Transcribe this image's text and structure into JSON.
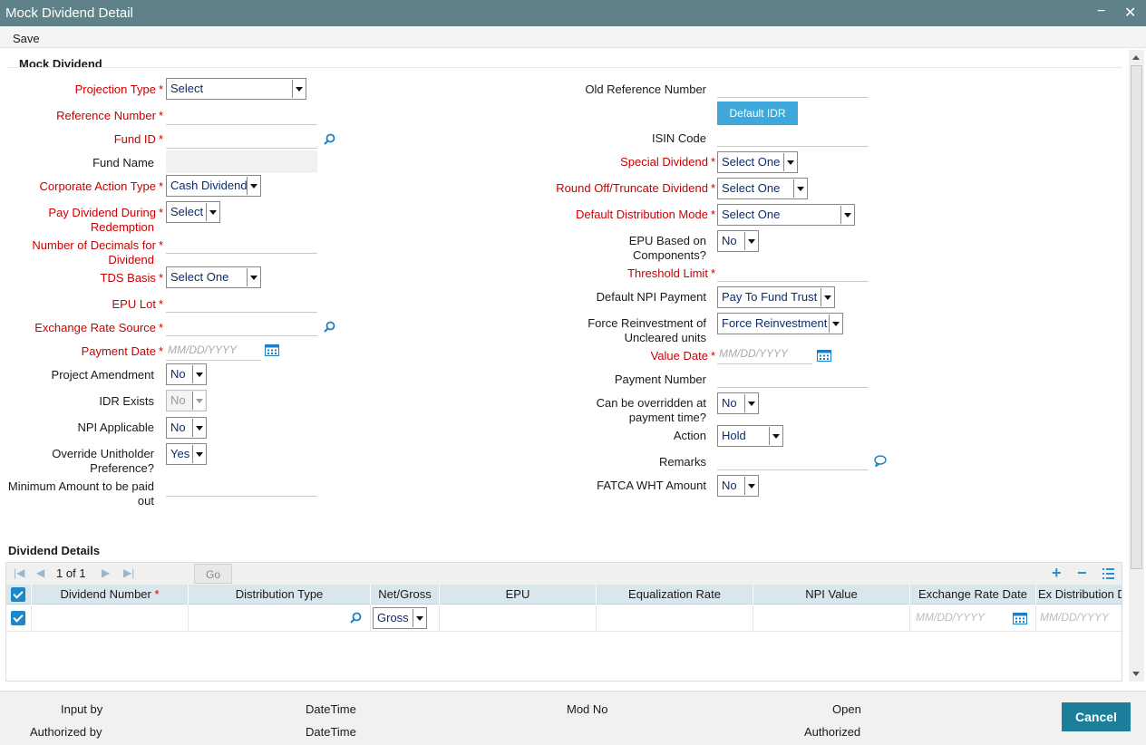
{
  "window": {
    "title": "Mock Dividend Detail",
    "minimize": "−",
    "close": "✕"
  },
  "toolbar": {
    "save": "Save"
  },
  "section": {
    "title": "Mock Dividend"
  },
  "left": {
    "projection_type": {
      "label": "Projection Type",
      "value": "Select"
    },
    "reference_number": {
      "label": "Reference Number"
    },
    "fund_id": {
      "label": "Fund ID"
    },
    "fund_name": {
      "label": "Fund Name"
    },
    "corporate_action_type": {
      "label": "Corporate Action Type",
      "value": "Cash Dividend"
    },
    "pay_dividend_during_redemption": {
      "label_1": "Pay Dividend During",
      "label_2": "Redemption",
      "value": "Select"
    },
    "number_of_decimals": {
      "label_1": "Number of Decimals for",
      "label_2": "Dividend"
    },
    "tds_basis": {
      "label": "TDS Basis",
      "value": "Select One"
    },
    "epu_lot": {
      "label": "EPU Lot"
    },
    "exchange_rate_source": {
      "label": "Exchange Rate Source"
    },
    "payment_date": {
      "label": "Payment Date",
      "placeholder": "MM/DD/YYYY"
    },
    "project_amendment": {
      "label": "Project Amendment",
      "value": "No"
    },
    "idr_exists": {
      "label": "IDR Exists",
      "value": "No"
    },
    "npi_applicable": {
      "label": "NPI Applicable",
      "value": "No"
    },
    "override_unitholder_preference": {
      "label_1": "Override Unitholder",
      "label_2": "Preference?",
      "value": "Yes"
    },
    "minimum_amount": {
      "label_1": "Minimum Amount to be paid",
      "label_2": "out"
    }
  },
  "right": {
    "old_reference_number": {
      "label": "Old Reference Number"
    },
    "default_idr_button": "Default IDR",
    "isin_code": {
      "label": "ISIN Code"
    },
    "special_dividend": {
      "label": "Special Dividend",
      "value": "Select One"
    },
    "round_off_truncate_dividend": {
      "label": "Round Off/Truncate Dividend",
      "value": "Select One"
    },
    "default_distribution_mode": {
      "label": "Default Distribution Mode",
      "value": "Select One"
    },
    "epu_based_on_components": {
      "label_1": "EPU Based on",
      "label_2": "Components?",
      "value": "No"
    },
    "threshold_limit": {
      "label": "Threshold Limit"
    },
    "default_npi_payment": {
      "label": "Default NPI Payment",
      "value": "Pay To Fund Trust"
    },
    "force_reinvestment": {
      "label_1": "Force Reinvestment of",
      "label_2": "Uncleared units",
      "value": "Force Reinvestment"
    },
    "value_date": {
      "label": "Value Date",
      "placeholder": "MM/DD/YYYY"
    },
    "payment_number": {
      "label": "Payment Number"
    },
    "can_be_overridden": {
      "label_1": "Can be overridden at",
      "label_2": "payment time?",
      "value": "No"
    },
    "action": {
      "label": "Action",
      "value": "Hold"
    },
    "remarks": {
      "label": "Remarks"
    },
    "fatca_wht_amount": {
      "label": "FATCA WHT Amount",
      "value": "No"
    }
  },
  "dividend_details": {
    "title": "Dividend Details",
    "pager": {
      "page": "1",
      "of": "of",
      "total": "1",
      "go": "Go"
    },
    "columns": [
      "Dividend Number",
      "Distribution Type",
      "Net/Gross",
      "EPU",
      "Equalization Rate",
      "NPI Value",
      "Exchange Rate Date",
      "Ex Distribution Date"
    ],
    "row": {
      "net_gross": "Gross",
      "exchange_rate_date_placeholder": "MM/DD/YYYY",
      "ex_distribution_date_placeholder": "MM/DD/YYYY"
    }
  },
  "footer": {
    "input_by": "Input by",
    "authorized_by": "Authorized by",
    "datetime_1": "DateTime",
    "datetime_2": "DateTime",
    "mod_no": "Mod No",
    "open": "Open",
    "authorized": "Authorized",
    "cancel": "Cancel"
  },
  "colors": {
    "titlebar": "#5f8289",
    "required": "#cc0000",
    "accent": "#3ea8da",
    "cancel": "#1b7e9a",
    "grid_header": "#d9e6ec"
  }
}
